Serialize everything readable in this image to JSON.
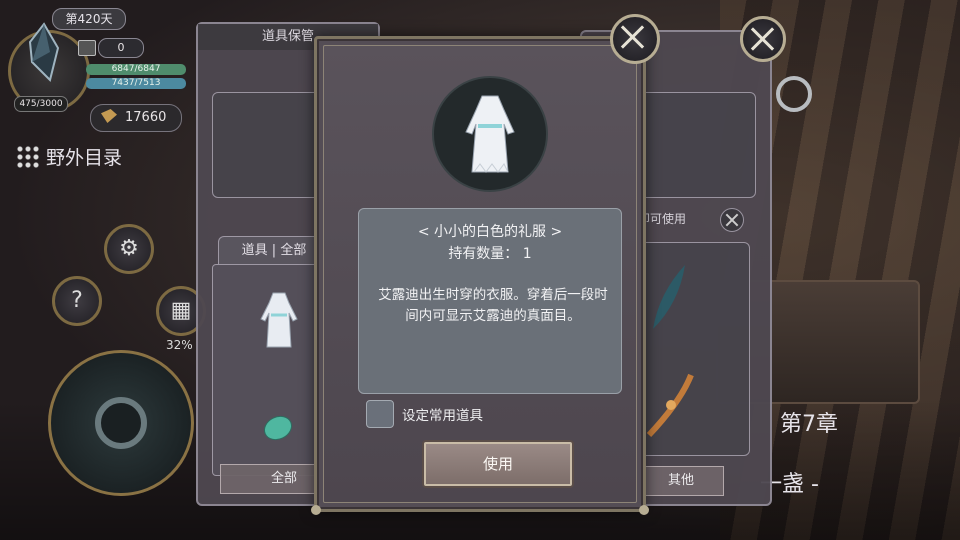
{
  "hud": {
    "day": "第420天",
    "counter": "0",
    "hp": "6847/6847",
    "mp": "7437/7513",
    "exp": "475/3000",
    "coins": "17660",
    "field_directory": "野外目录",
    "percent": "32%",
    "help_glyph": "?"
  },
  "world": {
    "chapter": "第7章",
    "lamp_text": "一盏 -"
  },
  "left_panel": {
    "title": "道具保管",
    "tab": "道具 | 全部",
    "all_button": "全部"
  },
  "right_panel": {
    "hint": "装备即可使用",
    "other_button": "其他"
  },
  "modal": {
    "item_name": "< 小小的白色的礼服 >",
    "quantity": "持有数量： 1",
    "description": "艾露迪出生时穿的衣服。穿着后一段时间内可显示艾露迪的真面目。",
    "favorite_label": "设定常用道具",
    "use_button": "使用"
  },
  "colors": {
    "panel": "#544d55",
    "info_box": "#6a7078",
    "frame": "#7e7562",
    "accent_gold": "#b7ad93"
  },
  "icons": [
    "close-icon",
    "gear-icon",
    "calendar-icon",
    "help-icon",
    "crystal-icon",
    "coin-icon",
    "grid-icon",
    "dress-icon",
    "leaf-icon",
    "gem-icon"
  ]
}
